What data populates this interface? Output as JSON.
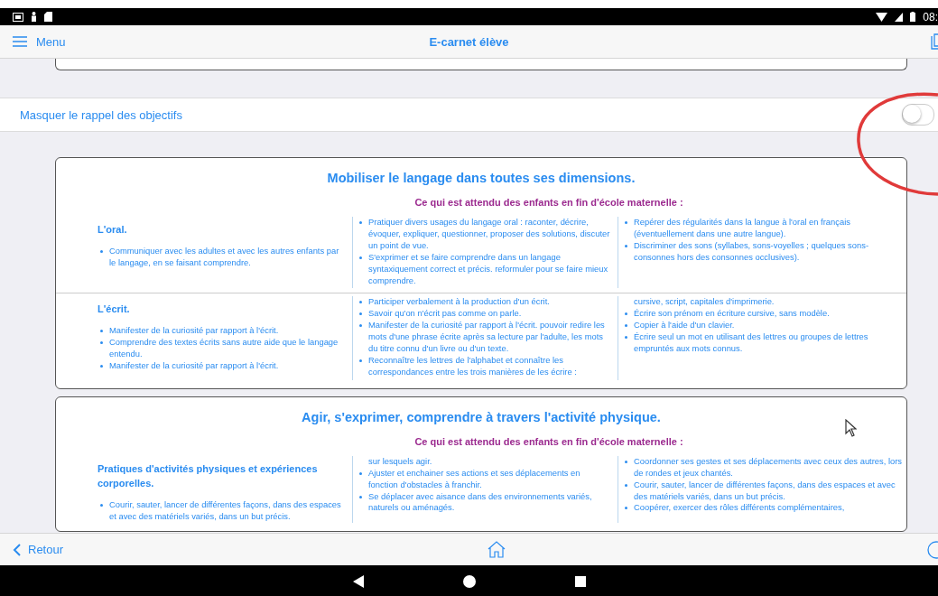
{
  "status_bar": {
    "time": "08:"
  },
  "nav_bar": {
    "menu_label": "Menu",
    "title": "E-carnet élève"
  },
  "toggle_row": {
    "label": "Masquer le rappel des objectifs",
    "on": false
  },
  "cards": [
    {
      "title": "Mobiliser le langage dans toutes ses dimensions.",
      "subtitle": "Ce qui est attendu des enfants en fin d'école maternelle :",
      "rows": [
        {
          "heading": "L'oral.",
          "items": [
            {
              "kind": "bullet",
              "text": "Communiquer avec les adultes et avec les autres enfants par le langage, en se faisant comprendre."
            }
          ],
          "column_2": [
            {
              "kind": "bullet",
              "text": "Pratiquer divers usages du langage oral : raconter, décrire, évoquer, expliquer, questionner, proposer des solutions, discuter un point de vue."
            },
            {
              "kind": "bullet",
              "text": "S'exprimer et se faire comprendre dans un langage syntaxiquement correct et précis. reformuler pour se faire mieux comprendre."
            }
          ],
          "column_3": [
            {
              "kind": "bullet",
              "text": "Repérer des régularités dans la langue à l'oral en français (éventuellement dans une autre langue)."
            },
            {
              "kind": "bullet",
              "text": "Discriminer des sons (syllabes, sons-voyelles ; quelques sons-consonnes hors des consonnes occlusives)."
            }
          ]
        },
        {
          "heading": "L'écrit.",
          "items": [
            {
              "kind": "bullet",
              "text": "Manifester de la curiosité par rapport à l'écrit."
            },
            {
              "kind": "bullet",
              "text": "Comprendre des textes écrits sans autre aide que le langage entendu."
            },
            {
              "kind": "bullet",
              "text": "Manifester de la curiosité par rapport à l'écrit."
            }
          ],
          "column_2": [
            {
              "kind": "bullet",
              "text": "Participer verbalement à la production d'un écrit."
            },
            {
              "kind": "bullet",
              "text": "Savoir qu'on n'écrit pas comme on parle."
            },
            {
              "kind": "bullet",
              "text": "Manifester de la curiosité par rapport à l'écrit. pouvoir redire les mots d'une phrase écrite après sa lecture par l'adulte, les mots du titre connu d'un livre ou d'un texte."
            },
            {
              "kind": "bullet",
              "text": "Reconnaître les lettres de l'alphabet et connaître les correspondances entre les trois manières de les écrire :"
            }
          ],
          "column_3": [
            {
              "kind": "continuation",
              "text": "cursive, script, capitales d'imprimerie."
            },
            {
              "kind": "bullet",
              "text": "Écrire son prénom en écriture cursive, sans modèle."
            },
            {
              "kind": "bullet",
              "text": "Copier à l'aide d'un clavier."
            },
            {
              "kind": "bullet",
              "text": "Écrire seul un mot en utilisant des lettres ou groupes de lettres empruntés aux mots connus."
            }
          ]
        }
      ]
    },
    {
      "title": "Agir, s'exprimer, comprendre à travers l'activité physique.",
      "subtitle": "Ce qui est attendu des enfants en fin d'école maternelle :",
      "rows": [
        {
          "heading": "Pratiques d'activités physiques et expériences corporelles.",
          "items": [
            {
              "kind": "bullet",
              "text": "Courir, sauter, lancer de différentes façons, dans des espaces et avec des matériels variés, dans un but précis."
            }
          ],
          "column_2": [
            {
              "kind": "continuation",
              "text": "sur lesquels agir."
            },
            {
              "kind": "bullet",
              "text": "Ajuster et enchainer ses actions et ses déplacements en fonction d'obstacles à franchir."
            },
            {
              "kind": "bullet",
              "text": "Se déplacer avec aisance dans des environnements variés, naturels ou aménagés."
            }
          ],
          "column_3": [
            {
              "kind": "bullet",
              "text": "Coordonner ses gestes et ses déplacements avec ceux des autres, lors de rondes et jeux chantés."
            },
            {
              "kind": "bullet",
              "text": "Courir, sauter, lancer de différentes façons, dans des espaces et avec des matériels variés, dans un but précis."
            },
            {
              "kind": "bullet",
              "text": "Coopérer, exercer des rôles différents complémentaires,"
            }
          ]
        }
      ]
    }
  ],
  "bottom_bar": {
    "back_label": "Retour"
  }
}
